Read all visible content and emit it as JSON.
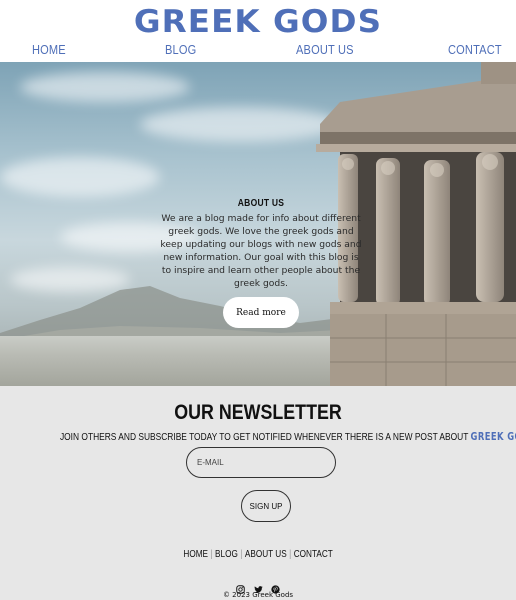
{
  "header": {
    "logo": "GREEK GODS",
    "nav": [
      "HOME",
      "BLOG",
      "ABOUT US",
      "CONTACT"
    ]
  },
  "hero": {
    "about_title": "ABOUT US",
    "about_text": "We are a blog made for info about different greek gods. We love the greek gods and keep updating our blogs with new gods and new information. Our goal with this blog is to inspire and learn other people about the greek gods.",
    "read_more_label": "Read more"
  },
  "newsletter": {
    "title": "OUR NEWSLETTER",
    "subtitle": "JOIN OTHERS AND SUBSCRIBE TODAY TO GET NOTIFIED WHENEVER THERE IS A NEW POST ABOUT",
    "brand": "GREEK GODS.",
    "email_placeholder": "E-MAIL",
    "signup_label": "SIGN UP"
  },
  "footer": {
    "nav": [
      "HOME",
      "BLOG",
      "ABOUT US",
      "CONTACT"
    ],
    "socials": [
      "instagram-icon",
      "twitter-icon",
      "pinterest-icon"
    ],
    "copyright": "© 2023 Greek Gods"
  },
  "colors": {
    "brand": "#4f6fb8",
    "newsletter_bg": "#e7e7e7"
  }
}
